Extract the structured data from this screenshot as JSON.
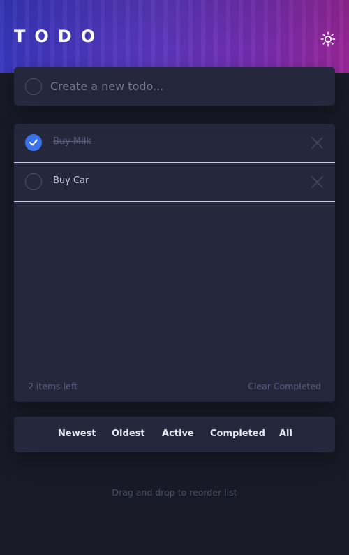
{
  "header": {
    "title": "TODO",
    "theme_icon": "sun-icon"
  },
  "create": {
    "placeholder": "Create a new todo..."
  },
  "todos": [
    {
      "text": "Buy Milk",
      "completed": true
    },
    {
      "text": "Buy Car",
      "completed": false
    }
  ],
  "footer": {
    "items_left": "2 items left",
    "clear_label": "Clear Completed"
  },
  "filters": [
    "Newest",
    "Oldest",
    "Active",
    "Completed",
    "All"
  ],
  "hint": "Drag and drop to reorder list",
  "colors": {
    "accent": "#3a73e9",
    "card": "#25273c",
    "background": "#181a27"
  }
}
